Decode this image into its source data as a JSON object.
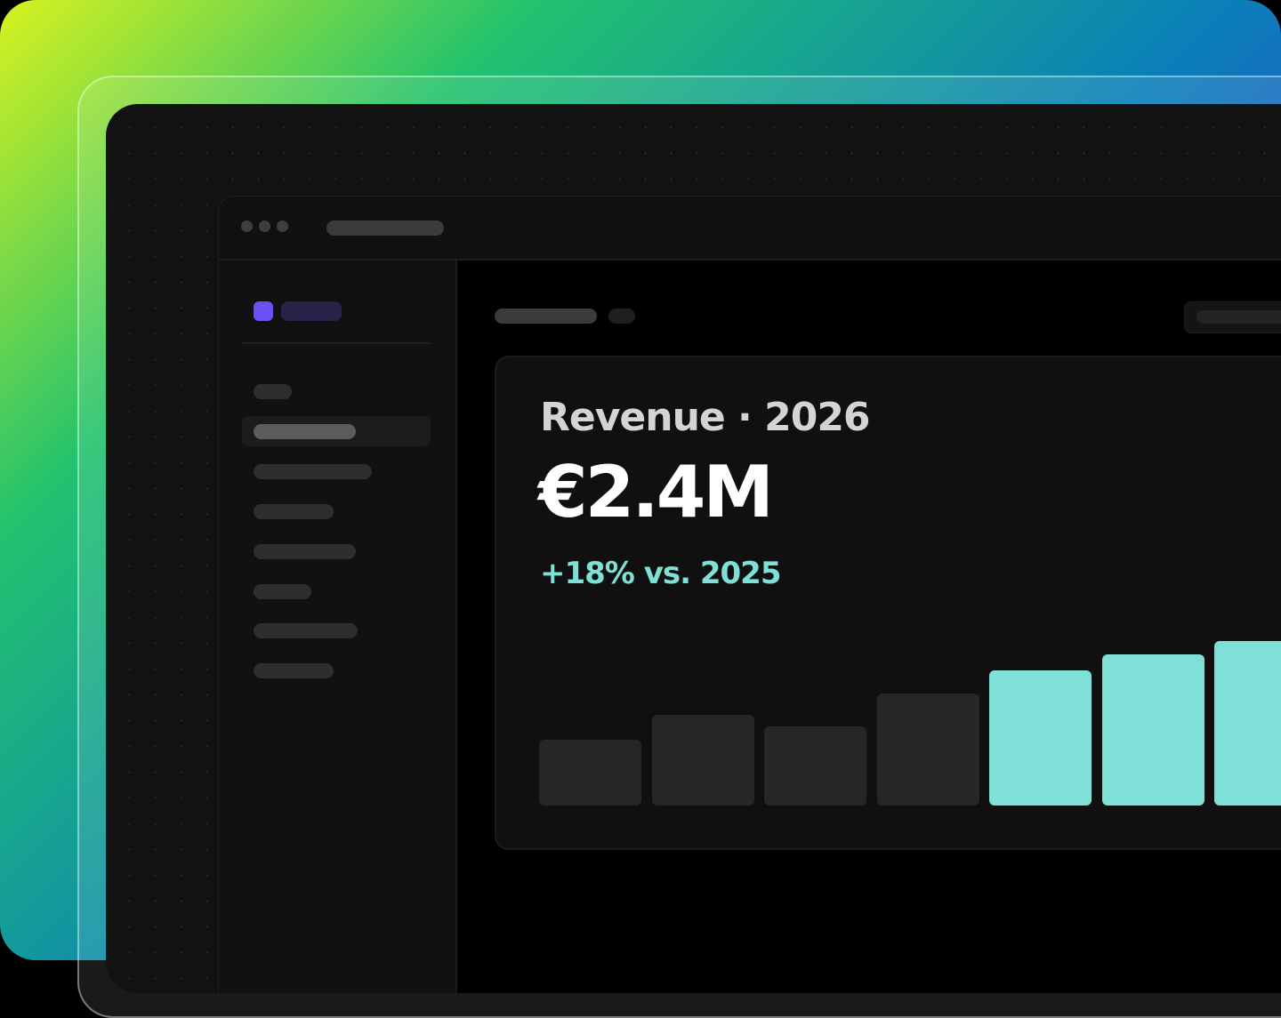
{
  "card": {
    "title": "Revenue · 2026",
    "value": "€2.4M",
    "delta": "+18% vs. 2025"
  },
  "colors": {
    "accent": "#7ee0d6",
    "brand": "#6c4ef5",
    "bar_muted": "#262626"
  },
  "chart_data": {
    "type": "bar",
    "values": [
      0.4,
      0.55,
      0.48,
      0.68,
      0.82,
      0.92,
      1.0
    ],
    "highlighted": [
      false,
      false,
      false,
      false,
      true,
      true,
      true
    ]
  }
}
